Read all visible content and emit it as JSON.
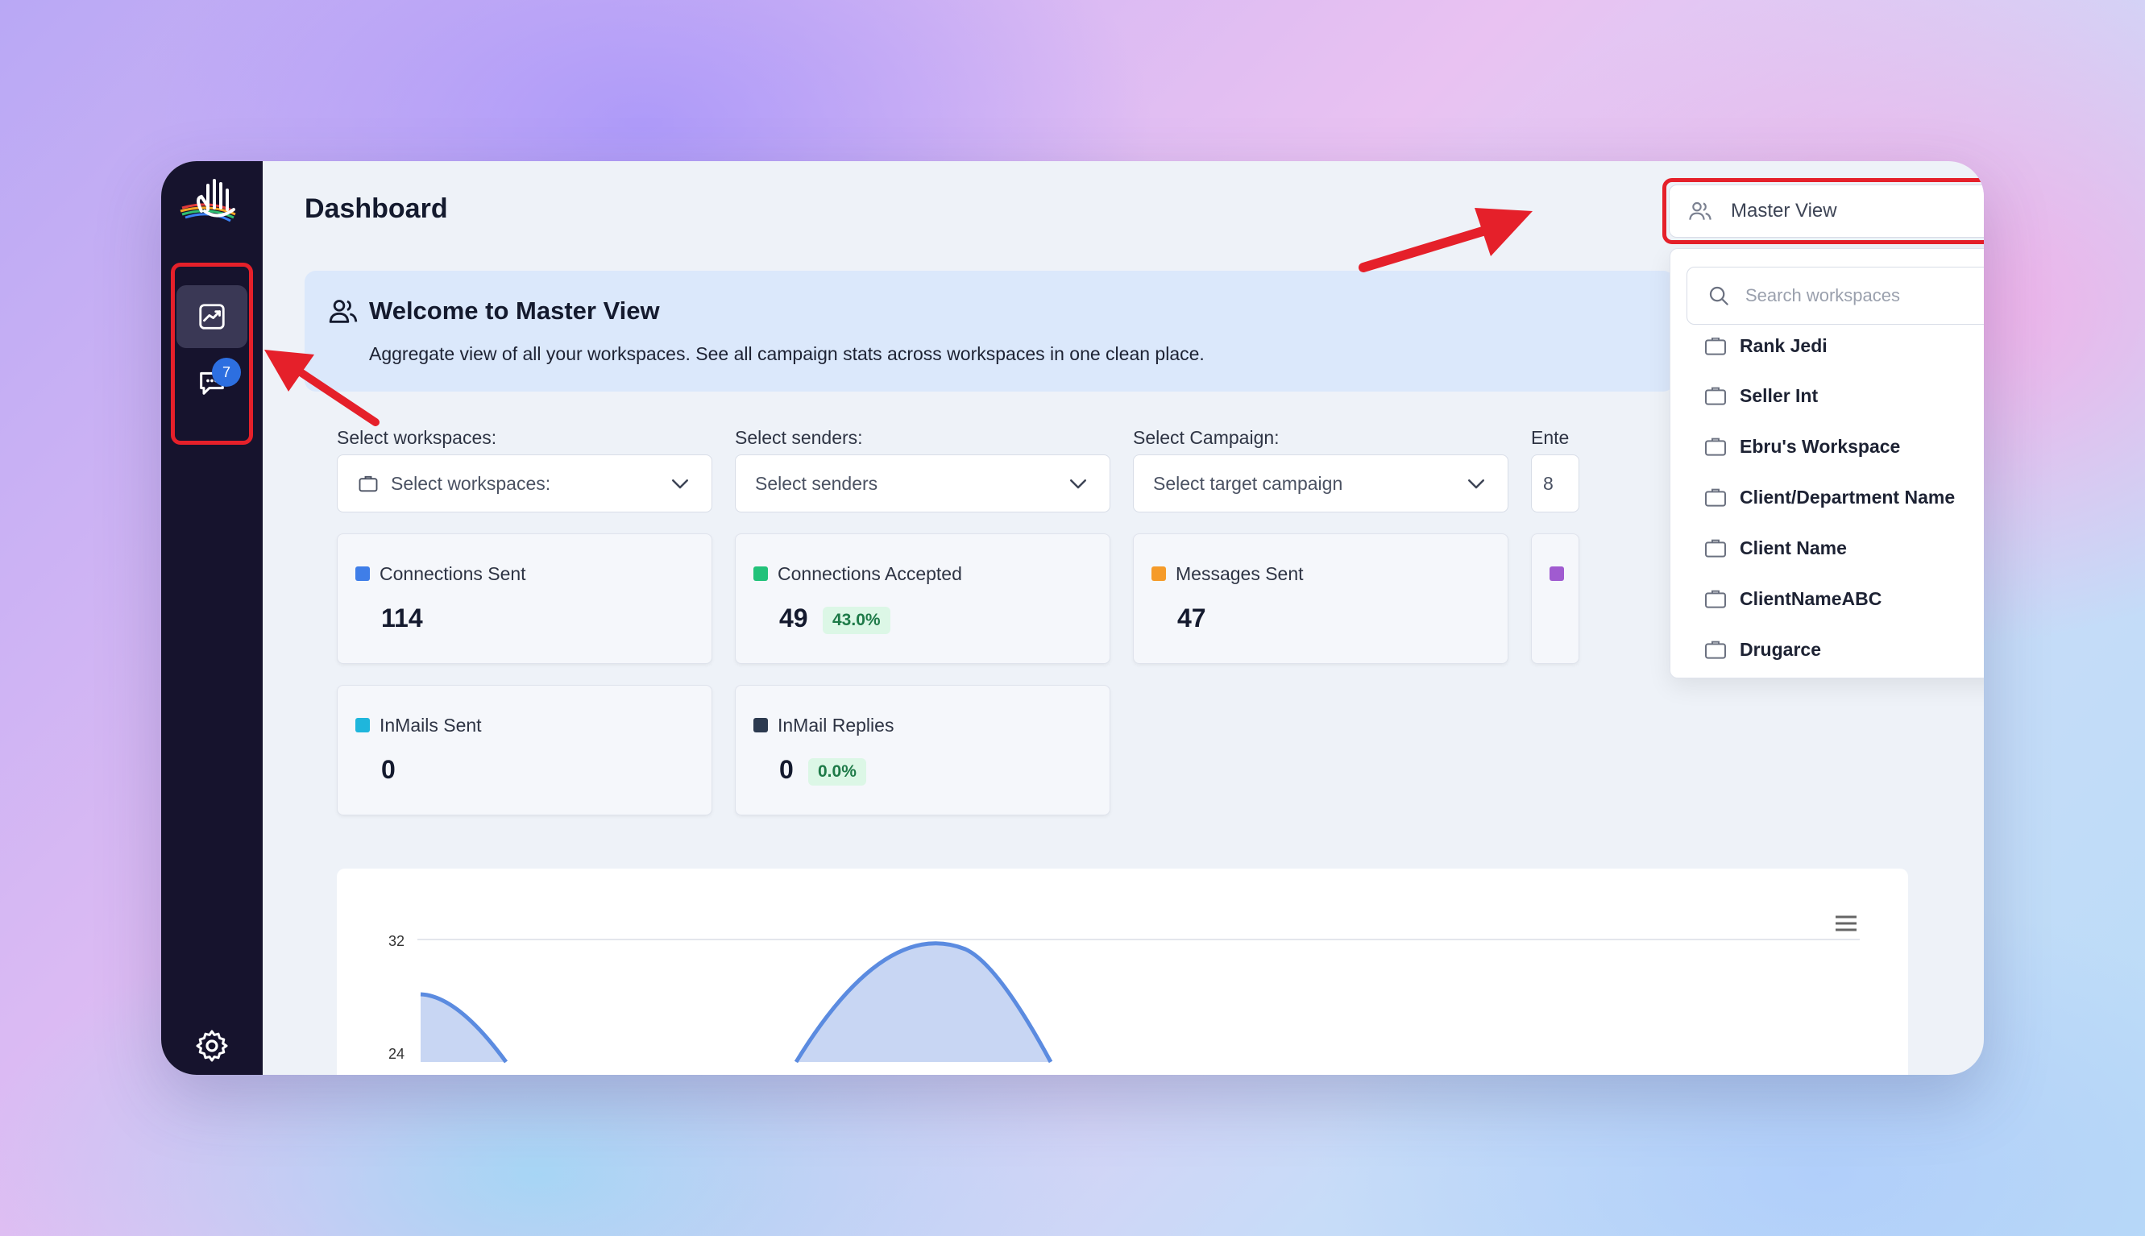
{
  "page": {
    "title": "Dashboard",
    "master_view_label": "Master View"
  },
  "sidebar": {
    "items": [
      {
        "name": "analytics",
        "icon": "trending-chart-icon",
        "active": true
      },
      {
        "name": "messages",
        "icon": "chat-bubble-icon",
        "badge": "7"
      }
    ],
    "settings_icon": "gear-icon"
  },
  "welcome": {
    "title": "Welcome to Master View",
    "subtitle": "Aggregate view of all your workspaces. See all campaign stats across workspaces in one clean place."
  },
  "filters": {
    "workspaces": {
      "label": "Select workspaces:",
      "placeholder": "Select workspaces:"
    },
    "senders": {
      "label": "Select senders:",
      "placeholder": "Select senders"
    },
    "campaign": {
      "label": "Select Campaign:",
      "placeholder": "Select target campaign"
    },
    "partial": {
      "label": "Ente",
      "value": "8"
    }
  },
  "stats": [
    {
      "title": "Connections Sent",
      "value": "114",
      "color": "#3f7ee8"
    },
    {
      "title": "Connections Accepted",
      "value": "49",
      "pct": "43.0%",
      "color": "#22c27a"
    },
    {
      "title": "Messages Sent",
      "value": "47",
      "color": "#f59b2a"
    },
    {
      "title": "InMails Sent",
      "value": "0",
      "color": "#1fb6dc"
    },
    {
      "title": "InMail Replies",
      "value": "0",
      "pct": "0.0%",
      "color": "#2c3a4f"
    }
  ],
  "partial_card_color": "#a05bd0",
  "workspace_dropdown": {
    "search_placeholder": "Search workspaces",
    "items": [
      "Rank Jedi",
      "Seller Int",
      "Ebru's Workspace",
      "Client/Department Name",
      "Client Name",
      "ClientNameABC",
      "Drugarce"
    ]
  },
  "chart_data": {
    "type": "area",
    "yticks": [
      "32",
      "24"
    ],
    "color": "#5b8be0"
  },
  "colors": {
    "sidebar_bg": "#16132d",
    "accent": "#1e66e0",
    "highlight": "#e5202a"
  }
}
